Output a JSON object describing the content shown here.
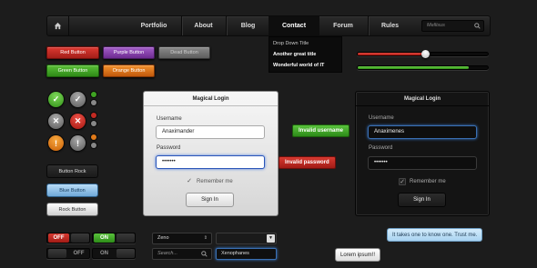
{
  "nav": {
    "items": [
      "Portfolio",
      "About",
      "Blog",
      "Contact",
      "Forum",
      "Rules"
    ],
    "search_placeholder": "Mellisus",
    "dropdown": [
      "Drop Down Title",
      "Another great title",
      "Wonderful world of IT"
    ]
  },
  "buttons": {
    "red": "Red Button",
    "purple": "Purple Button",
    "dead": "Dead Button",
    "green": "Green Button",
    "orange": "Orange Button"
  },
  "icons": {
    "check": "✓",
    "cross": "✕",
    "alert": "!"
  },
  "stacked_buttons": [
    "Button Rock",
    "Blue Button",
    "Rock Button"
  ],
  "light_login": {
    "title": "Magical Login",
    "username_label": "Username",
    "username_value": "Anaximander",
    "password_label": "Password",
    "password_value": "•••••••",
    "remember": "Remember me",
    "signin": "Sign In"
  },
  "dark_login": {
    "title": "Magical Login",
    "username_label": "Username",
    "username_value": "Anaximenes",
    "password_label": "Password",
    "password_value": "•••••••",
    "remember": "Remember me",
    "signin": "Sign In"
  },
  "tooltips": {
    "invalid_username": "Invalid username",
    "invalid_password": "Invalid password"
  },
  "sliders": {
    "red_level": 0.52,
    "green_level": 0.85
  },
  "toggles": [
    {
      "off": "OFF",
      "on": "ON"
    },
    {
      "off": "OFF",
      "on": "ON"
    }
  ],
  "selects": {
    "first": "Zeno",
    "search_placeholder": "Search...",
    "input_value": "Xenophanes"
  },
  "bubbles": {
    "blue": "It takes one to know one. Trust me.",
    "white": "Lorem ipsum!!"
  },
  "colors": {
    "red": "#c22a22",
    "green": "#3fa322",
    "orange": "#e07a1a",
    "purple": "#8a44ae",
    "blue_focus": "#3a6fb3"
  }
}
